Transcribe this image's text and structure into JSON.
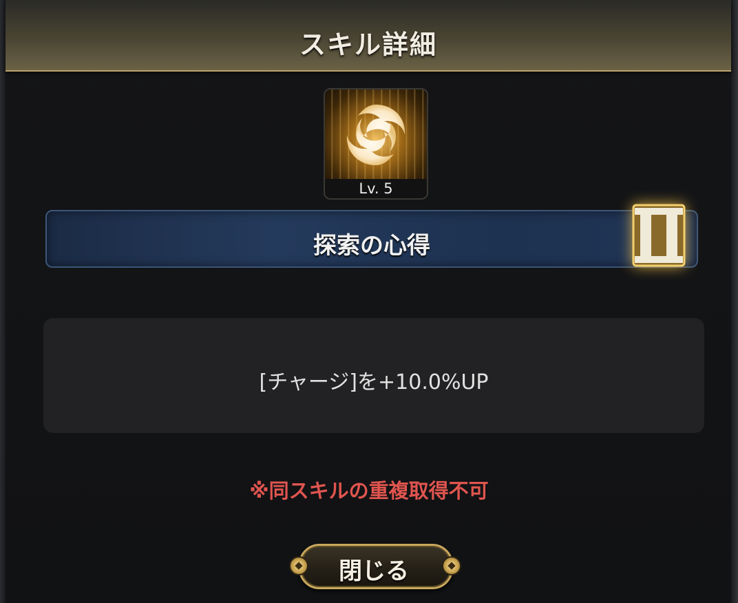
{
  "dialog": {
    "title": "スキル詳細"
  },
  "skill": {
    "icon": "swirl-icon",
    "level_label": "Lv. 5",
    "name": "探索の心得",
    "rank": "II",
    "description": "[チャージ]を+10.0%UP"
  },
  "notice": "※同スキルの重複取得不可",
  "buttons": {
    "close_label": "閉じる"
  },
  "colors": {
    "header_gold": "#6b6246",
    "name_bar_blue": "#243a5c",
    "warning_red": "#e0554f",
    "button_gold": "#c9a85d"
  }
}
